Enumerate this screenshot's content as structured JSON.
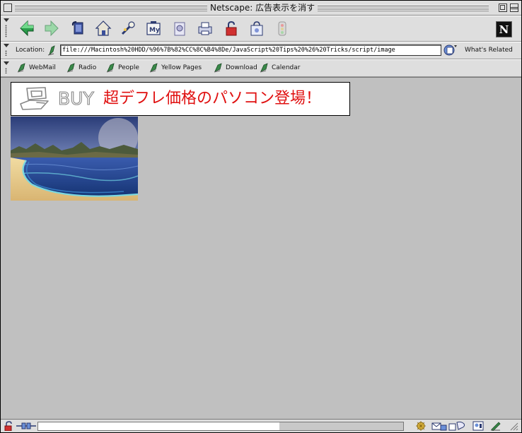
{
  "window": {
    "title": "Netscape: 広告表示を消す"
  },
  "navbar": {
    "buttons": [
      {
        "name": "back",
        "icon": "back-arrow-icon"
      },
      {
        "name": "forward",
        "icon": "forward-arrow-icon"
      },
      {
        "name": "reload",
        "icon": "reload-icon"
      },
      {
        "name": "home",
        "icon": "home-icon"
      },
      {
        "name": "search",
        "icon": "search-icon"
      },
      {
        "name": "my-netscape",
        "icon": "my-netscape-icon"
      },
      {
        "name": "images",
        "icon": "images-icon"
      },
      {
        "name": "print",
        "icon": "print-icon"
      },
      {
        "name": "security",
        "icon": "security-lock-icon"
      },
      {
        "name": "shop",
        "icon": "shop-icon"
      },
      {
        "name": "stop",
        "icon": "stop-icon"
      }
    ],
    "logo": "N"
  },
  "location": {
    "label": "Location:",
    "url": "file:///Macintosh%20HDD/%96%7B%82%CC%8C%B4%8De/JavaScript%20Tips%20%26%20Tricks/script/image",
    "related_label": "What's Related"
  },
  "personal_toolbar": {
    "items": [
      {
        "label": "WebMail"
      },
      {
        "label": "Radio"
      },
      {
        "label": "People"
      },
      {
        "label": "Yellow Pages"
      },
      {
        "label": "Download"
      },
      {
        "label": "Calendar"
      }
    ]
  },
  "content": {
    "banner": {
      "text": "超デフレ価格のパソコン登場！",
      "buy_label": "BUY"
    },
    "background_color": "#c0c0c0"
  },
  "colors": {
    "banner_text": "#e01010",
    "chrome": "#dedede"
  }
}
